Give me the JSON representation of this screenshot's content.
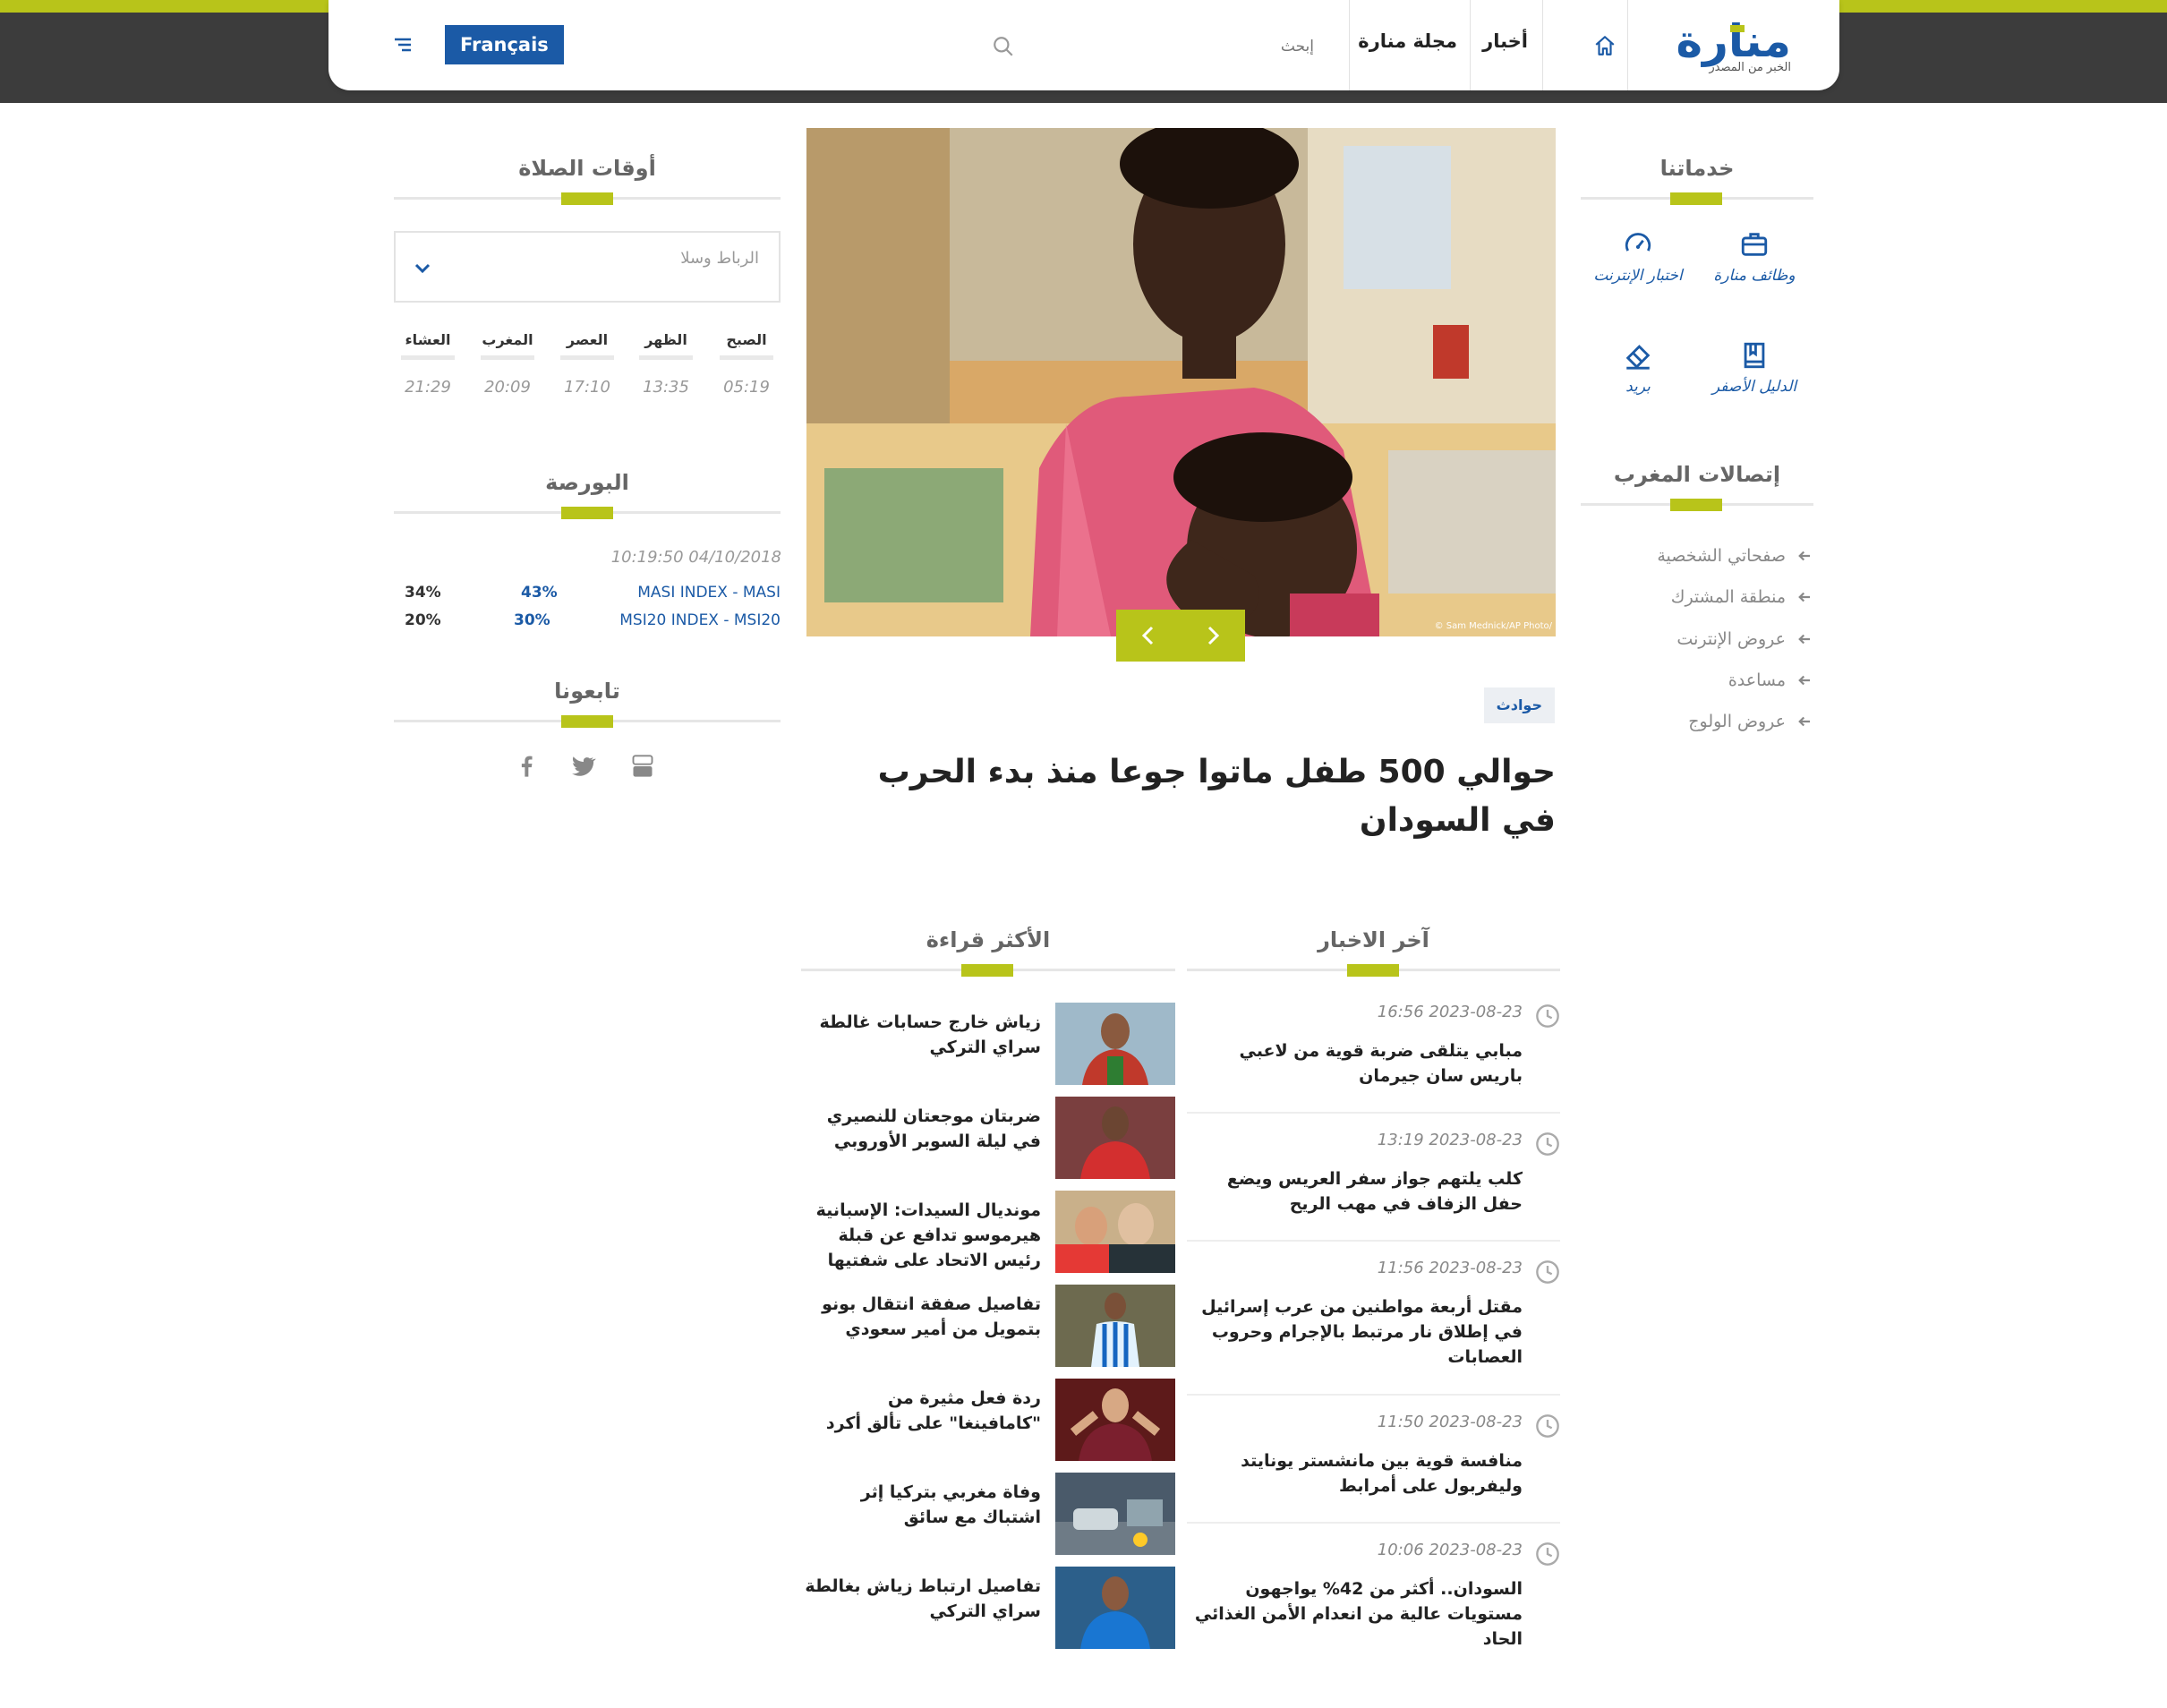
{
  "colors": {
    "brand_blue": "#1b5aa6",
    "accent_green": "#b8c41a",
    "topbar_dark": "#3c3c3c"
  },
  "header": {
    "logo_text": "منارة",
    "logo_tagline": "الخبر من المصدر",
    "nav": {
      "home_icon": "home-icon",
      "news": "أخبار",
      "magazine": "مجلة منارة"
    },
    "search_placeholder": "إبحث",
    "language_button": "Français",
    "menu_icon": "hamburger-menu-icon"
  },
  "services": {
    "title": "خدماتنا",
    "items": [
      {
        "label": "وظائف منارة",
        "icon": "briefcase-icon"
      },
      {
        "label": "اختبار الإنترنت",
        "icon": "speedometer-icon"
      },
      {
        "label": "الدليل الأصفر",
        "icon": "book-icon"
      },
      {
        "label": "بريد",
        "icon": "mail-icon"
      }
    ]
  },
  "iam": {
    "title": "إتصالات المغرب",
    "links": [
      "صفحاتي الشخصية",
      "منطقة المشترك",
      "عروض الإنترنت",
      "مساعدة",
      "عروض الولوج"
    ]
  },
  "featured": {
    "photo_credit": "© Sam Mednick/AP Photo/",
    "category": "حوادث",
    "headline": "حوالي 500 طفل ماتوا جوعا منذ بدء الحرب في السودان"
  },
  "prayer": {
    "title": "أوقات الصلاة",
    "city": "الرباط وسلا",
    "times": [
      {
        "name": "الصبح",
        "time": "05:19"
      },
      {
        "name": "الظهر",
        "time": "13:35"
      },
      {
        "name": "العصر",
        "time": "17:10"
      },
      {
        "name": "المغرب",
        "time": "20:09"
      },
      {
        "name": "العشاء",
        "time": "21:29"
      }
    ]
  },
  "bourse": {
    "title": "البورصة",
    "timestamp": "10:19:50 04/10/2018",
    "rows": [
      {
        "name": "MASI INDEX - MASI",
        "v1": "43%",
        "v2": "34%"
      },
      {
        "name": "MSI20 INDEX - MSI20",
        "v1": "30%",
        "v2": "20%"
      }
    ]
  },
  "follow": {
    "title": "تابعونا",
    "icons": [
      "youtube-icon",
      "twitter-icon",
      "facebook-icon"
    ]
  },
  "latest": {
    "title": "آخر الاخبار",
    "items": [
      {
        "time": "16:56 2023-08-23",
        "title": "مبابي يتلقى ضربة قوية من لاعبي باريس سان جيرمان"
      },
      {
        "time": "13:19 2023-08-23",
        "title": "كلب يلتهم جواز سفر العريس ويضع حفل الزفاف في مهب الريح"
      },
      {
        "time": "11:56 2023-08-23",
        "title": "مقتل أربعة مواطنين من عرب إسرائيل في إطلاق نار مرتبط بالإجرام وحروب العصابات"
      },
      {
        "time": "11:50 2023-08-23",
        "title": "منافسة قوية بين مانشستر يونايتد وليفربول على أمرابط"
      },
      {
        "time": "10:06 2023-08-23",
        "title": "السودان.. أكثر من 42% يواجهون مستويات عالية من انعدام الأمن الغذائي الحاد"
      }
    ]
  },
  "most_read": {
    "title": "الأكثر قراءة",
    "items": [
      {
        "title": "زياش خارج حسابات غالطة سراي التركي"
      },
      {
        "title": "ضربتان موجعتان للنصيري في ليلة السوبر الأوروبي"
      },
      {
        "title": "مونديال السيدات: الإسبانية هيرموسو تدافع عن قبلة رئيس الاتحاد على شفتيها"
      },
      {
        "title": "تفاصيل صفقة انتقال بونو بتمويل من أمير سعودي"
      },
      {
        "title": "ردة فعل مثيرة من \"كامافينغا\" على تألق أكرد"
      },
      {
        "title": "وفاة مغربي بتركيا إثر اشتباك مع سائق"
      },
      {
        "title": "تفاصيل ارتباط زياش بغالطة سراي التركي"
      }
    ]
  }
}
